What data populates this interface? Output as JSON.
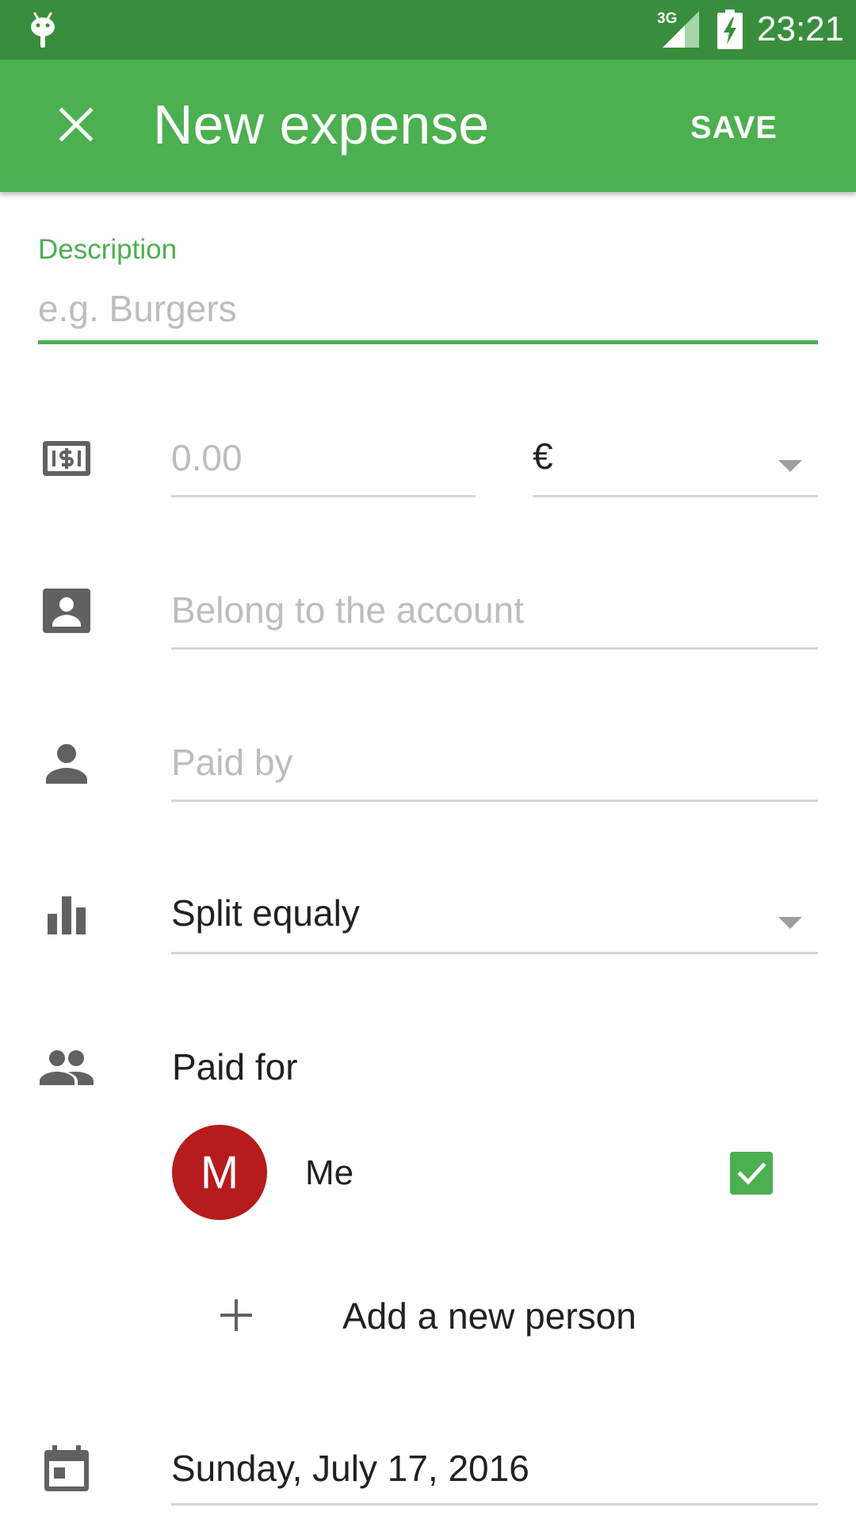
{
  "status_bar": {
    "network": "3G",
    "time": "23:21"
  },
  "toolbar": {
    "close_icon": "close-icon",
    "title": "New expense",
    "save_label": "SAVE"
  },
  "form": {
    "description": {
      "label": "Description",
      "placeholder": "e.g. Burgers",
      "value": ""
    },
    "amount": {
      "icon": "money-icon",
      "placeholder": "0.00",
      "value": ""
    },
    "currency": {
      "selected": "€"
    },
    "account": {
      "icon": "account-box-icon",
      "placeholder": "Belong to the account",
      "value": ""
    },
    "paid_by": {
      "icon": "person-icon",
      "placeholder": "Paid by",
      "value": ""
    },
    "split": {
      "icon": "bar-chart-icon",
      "selected": "Split equaly"
    },
    "paid_for": {
      "icon": "group-icon",
      "title": "Paid for",
      "people": [
        {
          "initial": "M",
          "name": "Me",
          "checked": true,
          "avatar_color": "#b71c1c"
        }
      ],
      "add_label": "Add a new person"
    },
    "date": {
      "icon": "calendar-icon",
      "value": "Sunday, July 17, 2016"
    }
  },
  "colors": {
    "status_bar": "#388e3c",
    "primary": "#4caf50",
    "icon_gray": "#616161",
    "hint_gray": "#bdbdbd",
    "avatar_red": "#b71c1c"
  }
}
